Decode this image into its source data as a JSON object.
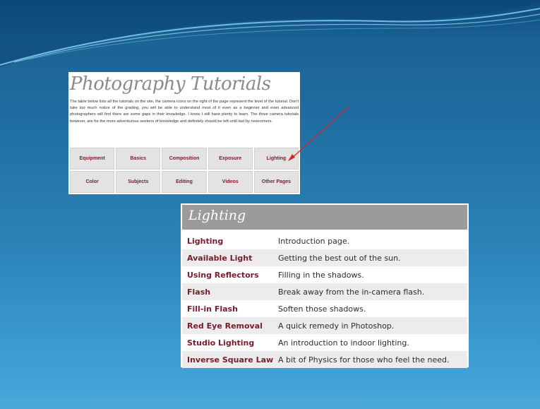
{
  "tutorials_panel": {
    "title": "Photography Tutorials",
    "intro_parts": [
      {
        "text": "The table below lists all the tutorials on the site, the camera icons on the right of the page represent the level of the tutorial. Don't take "
      },
      {
        "text": "too",
        "italic": true
      },
      {
        "text": " much notice of the grading, you will be able to understand most of it even as a beginner and even advanced photographers will find there are some gaps in their knowledge. I know I still have plenty to learn. The "
      },
      {
        "text": "three",
        "italic": true
      },
      {
        "text": " camera tutorials however, are for the more adventurous seekers of knowledge and definitely should be left until last by newcomers."
      }
    ],
    "nav_items": [
      "Equipment",
      "Basics",
      "Composition",
      "Exposure",
      "Lighting",
      "Color",
      "Subjects",
      "Editing",
      "Videos",
      "Other Pages"
    ]
  },
  "lighting_panel": {
    "title": "Lighting",
    "rows": [
      {
        "link": "Lighting",
        "desc": "Introduction page."
      },
      {
        "link": "Available Light",
        "desc": "Getting the best out of the sun."
      },
      {
        "link": "Using Reflectors",
        "desc": "Filling in the shadows."
      },
      {
        "link": "Flash",
        "desc": "Break away from the in-camera flash."
      },
      {
        "link": "Fill-in Flash",
        "desc": "Soften those shadows."
      },
      {
        "link": "Red Eye Removal",
        "desc": "A quick remedy in Photoshop."
      },
      {
        "link": "Studio Lighting",
        "desc": "An introduction to indoor lighting."
      },
      {
        "link": "Inverse Square Law",
        "desc": "A bit of Physics for those who feel the need."
      }
    ]
  },
  "colors": {
    "link": "#7a1b2c",
    "header_bar": "#9b9b9b",
    "arrow": "#d9232a"
  }
}
